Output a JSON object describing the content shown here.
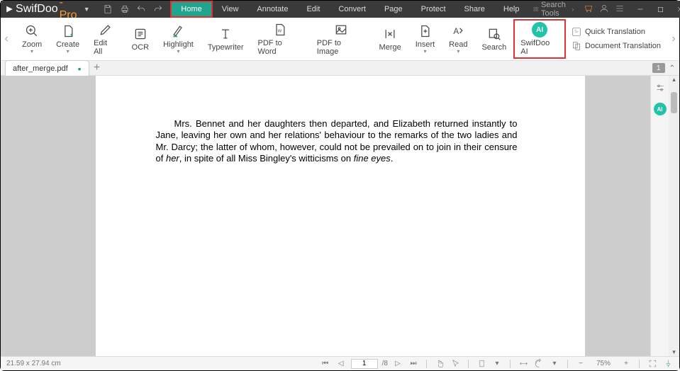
{
  "brand": {
    "name": "SwifDoo",
    "suffix": "-Pro"
  },
  "menu": [
    "Home",
    "View",
    "Annotate",
    "Edit",
    "Convert",
    "Page",
    "Protect",
    "Share",
    "Help"
  ],
  "menu_active_index": 0,
  "searchTools": "Search Tools",
  "ribbon": {
    "zoom": "Zoom",
    "create": "Create",
    "editAll": "Edit All",
    "ocr": "OCR",
    "highlight": "Highlight",
    "typewriter": "Typewriter",
    "pdf2word": "PDF to Word",
    "pdf2image": "PDF to Image",
    "merge": "Merge",
    "insert": "Insert",
    "read": "Read",
    "search": "Search",
    "swifdooAI": "SwifDoo AI"
  },
  "translate": {
    "quick": "Quick Translation",
    "doc": "Document Translation"
  },
  "tab": {
    "filename": "after_merge.pdf",
    "pageBadge": "1"
  },
  "document": {
    "paragraph_pre": "Mrs. Bennet and her daughters then departed, and Elizabeth returned instantly to Jane, leaving her own and her relations' behaviour to the remarks of the two ladies and Mr. Darcy; the latter of whom, however, could not be prevailed on to join in their censure of ",
    "word_her": "her",
    "paragraph_mid": ", in spite of all Miss Bingley's witticisms on ",
    "word_fine_eyes": "fine eyes",
    "period": "."
  },
  "status": {
    "dims": "21.59 x 27.94 cm",
    "currentPage": "1",
    "totalPages": "/8",
    "zoom": "75%"
  }
}
